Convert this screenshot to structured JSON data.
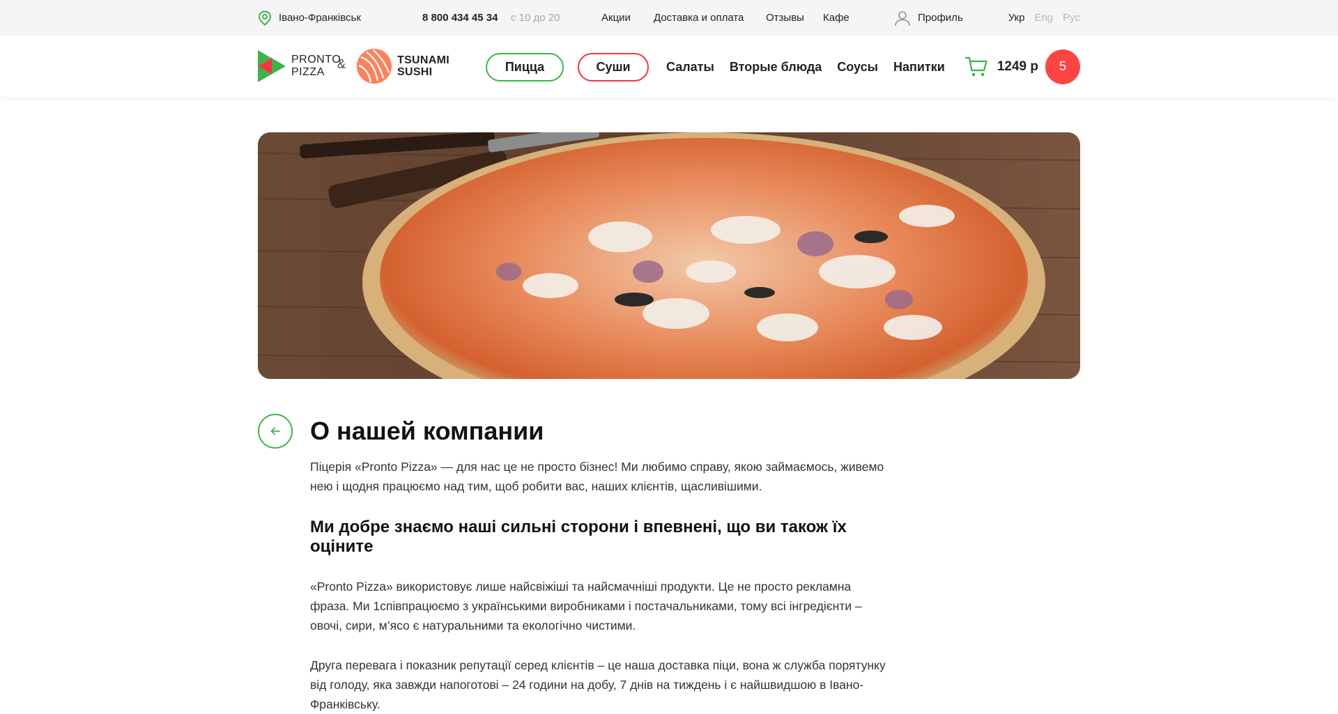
{
  "topbar": {
    "city": "Івано-Франківськ",
    "phone": "8 800 434 45 34",
    "hours": "с 10 до 20",
    "links": {
      "promo": "Акции",
      "delivery": "Доставка и оплата",
      "reviews": "Отзывы",
      "cafe": "Кафе"
    },
    "profile": "Профиль",
    "languages": [
      "Укр",
      "Eng",
      "Рус"
    ],
    "active_language": "Укр"
  },
  "header": {
    "logo_pronto_line1": "PRONTO",
    "logo_pronto_line2": "PIZZA",
    "logo_amp": "&",
    "logo_tsunami_line1": "TSUNAMI",
    "logo_tsunami_line2": "SUSHI",
    "nav": {
      "pizza": "Пицца",
      "sushi": "Суши",
      "salads": "Салаты",
      "mains": "Вторые блюда",
      "sauces": "Соусы",
      "drinks": "Напитки"
    },
    "cart_total": "1249 р",
    "cart_count": "5"
  },
  "page": {
    "title": "О нашей компании",
    "paragraph1": "Піцерія «Pronto Pizza» — для нас це не просто бізнес! Ми любимо справу, якою займаємось, живемо нею і щодня працюємо над тим, щоб робити вас, наших клієнтів, щасливішими.",
    "heading": "Ми добре знаємо наші сильні сторони і впевнені, що ви також їх оціните",
    "paragraph2": "«Pronto Pizza» використовує лише найсвіжіші та найсмачніші продукти. Це не просто рекламна фраза. Ми 1співпрацюємо з українськими виробниками і постачальниками, тому всі інгредієнти – овочі, сири, м’ясо є натуральними та екологічно чистими.",
    "paragraph3": "Друга перевага і показник репутації серед клієнтів – це наша доставка піци, вона ж служба порятунку від голоду, яка завжди напоготові – 24 години на добу, 7 днів на тиждень і є найшвидшою в Івано-Франківську."
  },
  "colors": {
    "accent_green": "#3bb54a",
    "accent_red": "#f2353e",
    "badge_red": "#ff4444",
    "topbar_bg": "#f5f5f5"
  },
  "icons": [
    "location-pin-icon",
    "user-icon",
    "cart-icon",
    "arrow-left-icon"
  ]
}
